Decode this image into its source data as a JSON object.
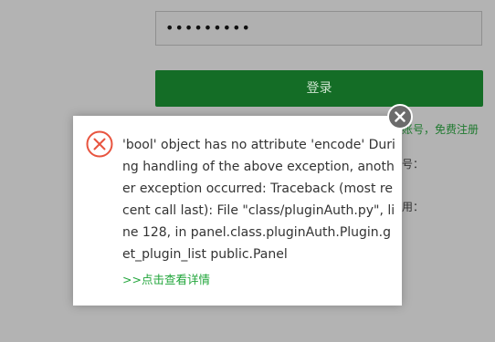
{
  "login": {
    "password_value": "•••••••••",
    "login_label": "登录",
    "register_text": "账号，免费注册"
  },
  "background_fragments": [
    "号：",
    "用："
  ],
  "dialog": {
    "message": "'bool' object has no attribute 'encode' During handling of the above exception, another exception occurred: Traceback (most recent call last): File \"class/pluginAuth.py\", line 128, in panel.class.pluginAuth.Plugin.get_plugin_list public.Panel",
    "details_link": ">>点击查看详情",
    "error_icon": "circle-x-icon",
    "close_icon": "close-icon"
  },
  "colors": {
    "accent": "#20a53a",
    "button": "#146d26",
    "error": "#e8543f",
    "overlay": "#b3b3b3"
  }
}
